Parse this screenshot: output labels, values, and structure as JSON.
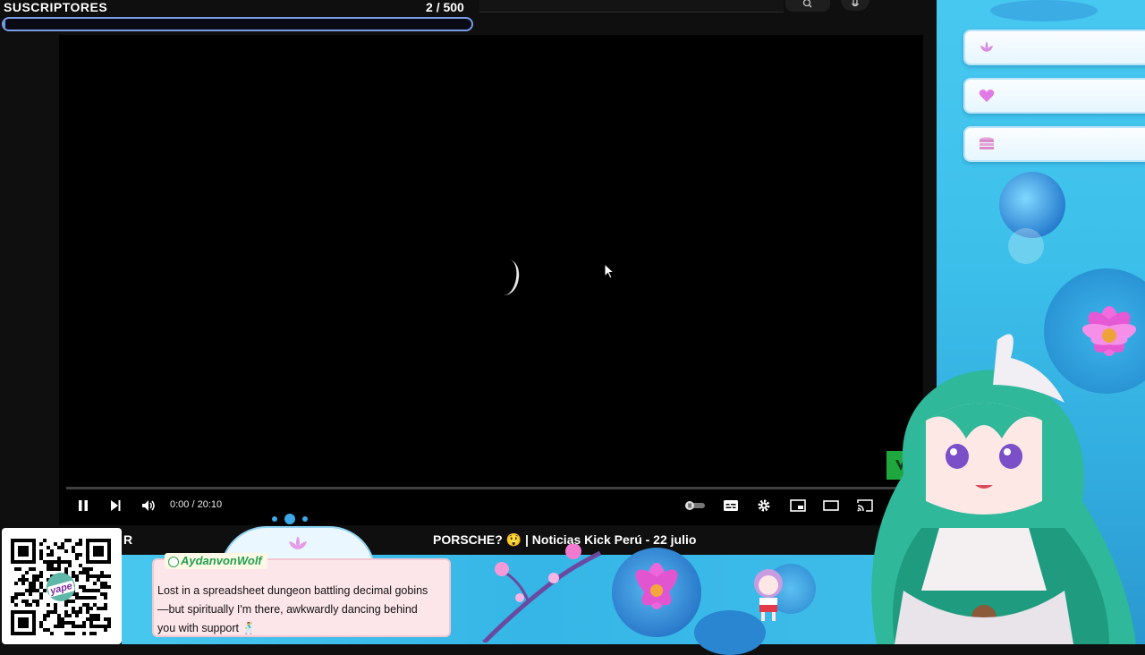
{
  "overlay": {
    "subs_label": "SUSCRIPTORES",
    "subs_count": "2",
    "subs_goal": "/ 500",
    "subs_progress": 0.004,
    "goal_icons": [
      "lotus-icon",
      "heart-icon",
      "coin-stack-icon"
    ]
  },
  "player": {
    "time": "0:00 / 20:10",
    "loading": true
  },
  "video": {
    "title_fragment": "PORSCHE? 😲 | Noticias Kick Perú - 22 julio",
    "left_fragment": "R"
  },
  "chat": {
    "username": "AydanvonWolf",
    "message": "Lost in a spreadsheet dungeon battling decimal gobins—but spiritually I'm there, awkwardly dancing behind you with support 🕺"
  },
  "qr": {
    "brand": "yape"
  },
  "colors": {
    "accent_blue": "#7a9be8",
    "overlay_cyan": "#3cc0ea",
    "chat_pink": "#fde6ea",
    "username_green": "#20a050",
    "yt_green": "#1fa63f"
  }
}
